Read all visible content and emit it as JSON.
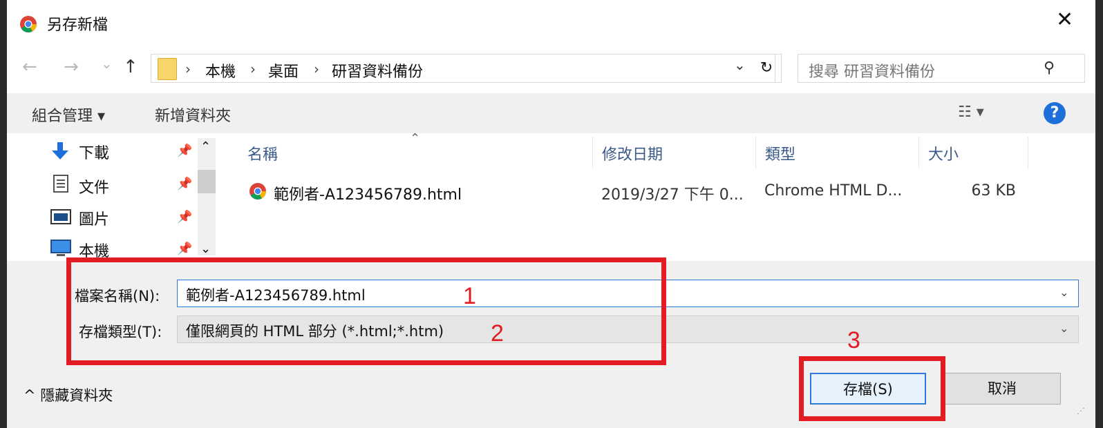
{
  "window": {
    "title": "另存新檔",
    "close_glyph": "✕"
  },
  "navigation": {
    "back_glyph": "←",
    "forward_glyph": "→",
    "recent_glyph": "⌄",
    "up_glyph": "↑",
    "breadcrumb": [
      "本機",
      "桌面",
      "研習資料備份"
    ],
    "separator": "›",
    "dropdown_glyph": "⌄",
    "refresh_glyph": "↻",
    "search_placeholder": "搜尋 研習資料備份",
    "search_glyph": "⚲"
  },
  "toolbar": {
    "organize_label": "組合管理 ▾",
    "new_folder_label": "新增資料夾",
    "view_glyph": "☷ ▾",
    "help_glyph": "?"
  },
  "nav_pane": {
    "items": [
      {
        "label": "下載",
        "icon": "download-icon"
      },
      {
        "label": "文件",
        "icon": "document-icon"
      },
      {
        "label": "圖片",
        "icon": "pictures-icon"
      },
      {
        "label": "本機",
        "icon": "computer-icon"
      }
    ],
    "pin_glyph": "📌",
    "scroll_up": "⌃",
    "scroll_down": "⌄"
  },
  "file_list": {
    "sort_glyph": "⌃",
    "columns": [
      "名稱",
      "修改日期",
      "類型",
      "大小"
    ],
    "rows": [
      {
        "name": "範例者-A123456789.html",
        "modified": "2019/3/27 下午 0...",
        "type": "Chrome HTML D...",
        "size": "63 KB"
      }
    ]
  },
  "form": {
    "filename_label": "檔案名稱(N):",
    "filename_value": "範例者-A123456789.html",
    "filetype_label": "存檔類型(T):",
    "filetype_value": "僅限網頁的 HTML 部分 (*.html;*.htm)",
    "combo_glyph": "⌄"
  },
  "footer": {
    "hide_folders_label": "^ 隱藏資料夾",
    "save_label": "存檔(S)",
    "cancel_label": "取消"
  },
  "annotations": [
    "1",
    "2",
    "3"
  ],
  "colors": {
    "annotation": "#e31b23",
    "accent": "#2c7ad6",
    "help": "#1e6fd9"
  }
}
